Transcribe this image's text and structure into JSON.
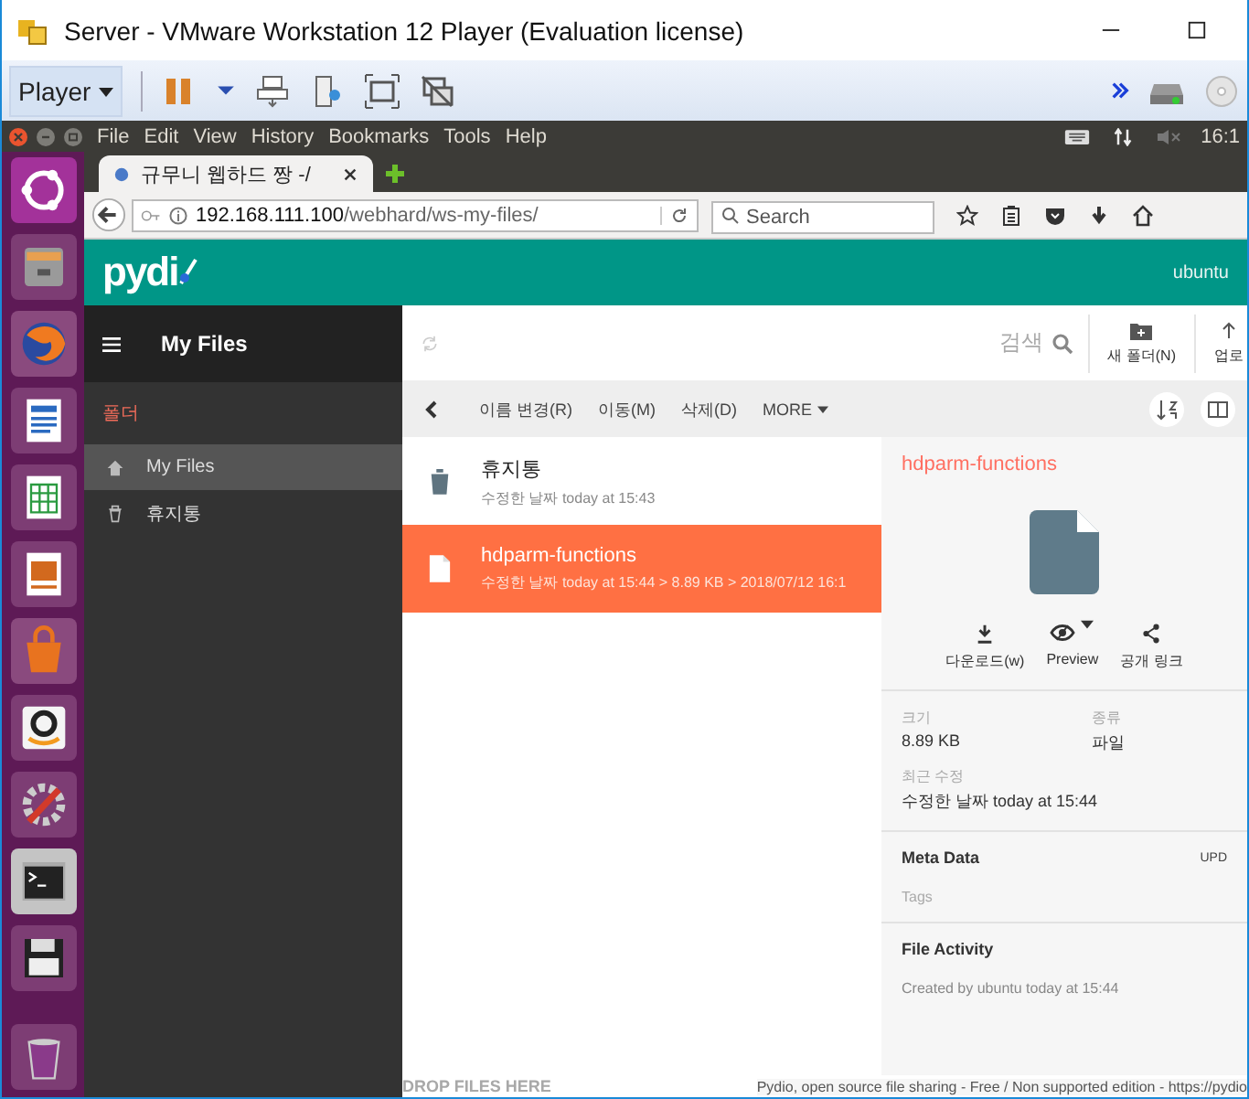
{
  "window": {
    "title": "Server - VMware Workstation 12 Player (Evaluation license)"
  },
  "vm_toolbar": {
    "player_menu": "Player"
  },
  "guest_menu": [
    "File",
    "Edit",
    "View",
    "History",
    "Bookmarks",
    "Tools",
    "Help"
  ],
  "guest_clock": "16:1",
  "launcher": [
    {
      "kind": "ubuntu"
    },
    {
      "kind": "files"
    },
    {
      "kind": "browser"
    },
    {
      "kind": "writer"
    },
    {
      "kind": "calc"
    },
    {
      "kind": "impress"
    },
    {
      "kind": "store"
    },
    {
      "kind": "amazon"
    },
    {
      "kind": "settings"
    },
    {
      "kind": "terminal"
    },
    {
      "kind": "floppy"
    },
    {
      "kind": "trash"
    }
  ],
  "browser": {
    "tab_title": "규무니 웹하드 짱 -/",
    "url_host": "192.168.111.100",
    "url_path": "/webhard/ws-my-files/",
    "search_placeholder": "Search"
  },
  "pydio": {
    "logo": "pydi",
    "user": "ubuntu",
    "workspace_title": "My Files",
    "search_label": "검색",
    "new_folder": "새 폴더(N)",
    "upload": "업로"
  },
  "sidebar": {
    "section": "폴더",
    "items": [
      {
        "label": "My Files",
        "kind": "home",
        "selected": true
      },
      {
        "label": "휴지통",
        "kind": "trash",
        "selected": false
      }
    ]
  },
  "actions": [
    "이름 변경(R)",
    "이동(M)",
    "삭제(D)"
  ],
  "more": "MORE",
  "files": [
    {
      "name": "휴지통",
      "kind": "trash",
      "meta": "수정한 날짜 today at 15:43",
      "selected": false
    },
    {
      "name": "hdparm-functions",
      "kind": "file",
      "meta": "수정한 날짜 today at 15:44 > 8.89 KB > 2018/07/12 16:1",
      "selected": true
    }
  ],
  "detail": {
    "title": "hdparm-functions",
    "actions": [
      {
        "label": "다운로드(w)",
        "kind": "download"
      },
      {
        "label": "Preview",
        "kind": "preview"
      },
      {
        "label": "공개 링크",
        "kind": "share"
      }
    ],
    "fields": [
      {
        "label": "크기",
        "value": "8.89 KB"
      },
      {
        "label": "종류",
        "value": "파일"
      },
      {
        "label": "최근 수정",
        "value": "수정한 날짜 today at 15:44"
      }
    ],
    "meta_title": "Meta Data",
    "meta_action": "UPD",
    "tags": "Tags",
    "activity_title": "File Activity",
    "activity": "Created by ubuntu today at 15:44"
  },
  "footer": {
    "drop": "DROP FILES HERE",
    "note": "Pydio, open source file sharing - Free / Non supported edition - https://pydio"
  }
}
